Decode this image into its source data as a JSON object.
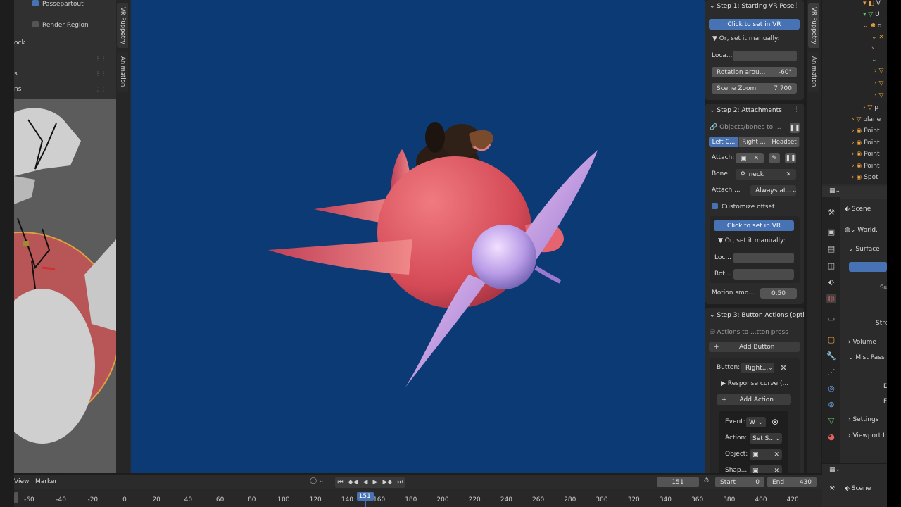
{
  "left_panel": {
    "passepartout": "Passepartout",
    "render_region": "Render Region",
    "row_ock": "ock",
    "row_s": "s",
    "row_ns": "ns"
  },
  "side_tabs": {
    "vr_puppetry": "VR Puppetry",
    "animation": "Animation"
  },
  "step1": {
    "title": "Step 1: Starting VR Pose",
    "set_vr_btn": "Click to set in VR",
    "manual_toggle": "Or, set it manually:",
    "location_label": "Loca...",
    "rotation_label": "Rotation arou...",
    "rotation_value": "-60°",
    "zoom_label": "Scene Zoom",
    "zoom_value": "7.700"
  },
  "step2": {
    "title": "Step 2: Attachments",
    "objects_label": "Objects/bones to ...",
    "tabs": [
      "Left C...",
      "Right ...",
      "Headset"
    ],
    "attach_label": "Attach:",
    "bone_label": "Bone:",
    "bone_value": "neck",
    "attach_mode_label": "Attach ...",
    "attach_mode_value": "Always at...",
    "customize_offset": "Customize offset",
    "set_vr_btn": "Click to set in VR",
    "manual_toggle": "Or, set it manually:",
    "loc_label": "Loc...",
    "rot_label": "Rot...",
    "motion_label": "Motion smo...",
    "motion_value": "0.50"
  },
  "step3": {
    "title": "Step 3: Button Actions (opti",
    "actions_label": "Actions to ...tton press",
    "add_button": "Add Button",
    "button_label": "Button:",
    "button_value": "Right...",
    "response_curve": "Response curve (...",
    "add_action": "Add Action",
    "event_label": "Event:",
    "event_value": "W",
    "action_label": "Action:",
    "action_value": "Set S...",
    "object_label": "Object:",
    "shape_label": "Shap..."
  },
  "outliner": [
    "V",
    "U",
    "d",
    "p",
    "plane",
    "Point",
    "Point",
    "Point",
    "Point",
    "Spot"
  ],
  "properties": {
    "scene": "Scene",
    "world": "World.",
    "surface": "Surface",
    "su": "Su",
    "stre": "Stre",
    "volume": "Volume",
    "mist": "Mist Pass",
    "d": "D",
    "f": "F",
    "settings": "Settings",
    "viewport": "Viewport I",
    "scene2": "Scene"
  },
  "timeline": {
    "view": "View",
    "marker": "Marker",
    "current_frame": "151",
    "start_label": "Start",
    "start_value": "0",
    "end_label": "End",
    "end_value": "430",
    "ticks": [
      "-60",
      "-40",
      "-20",
      "0",
      "20",
      "40",
      "60",
      "80",
      "100",
      "120",
      "140",
      "151",
      "160",
      "180",
      "200",
      "220",
      "240",
      "260",
      "280",
      "300",
      "320",
      "340",
      "360",
      "380",
      "400",
      "420"
    ]
  },
  "colors": {
    "viewport_bg": "#0b3a74",
    "accent": "#4772b3",
    "plane": "#e0606a",
    "propeller": "#c9a0e8"
  }
}
